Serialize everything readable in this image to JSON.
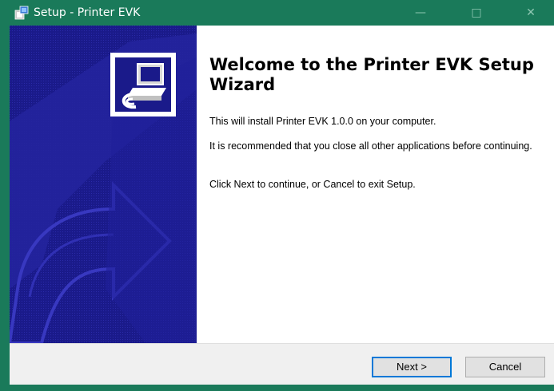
{
  "window": {
    "title": "Setup - Printer EVK",
    "minimize_glyph": "—",
    "maximize_glyph": "□",
    "close_glyph": "✕"
  },
  "wizard": {
    "heading": "Welcome to the Printer EVK Setup Wizard",
    "paragraphs": [
      "This will install Printer EVK 1.0.0 on your computer.",
      "It is recommended that you close all other applications before continuing.",
      "Click Next to continue, or Cancel to exit Setup."
    ]
  },
  "buttons": {
    "next": "Next >",
    "cancel": "Cancel"
  },
  "colors": {
    "titlebar": "#1a7a5a",
    "sidebar": "#1a1a8a",
    "accent": "#0078d7"
  },
  "icons": {
    "app": "setup-installer-icon",
    "wizard": "computer-install-icon"
  }
}
